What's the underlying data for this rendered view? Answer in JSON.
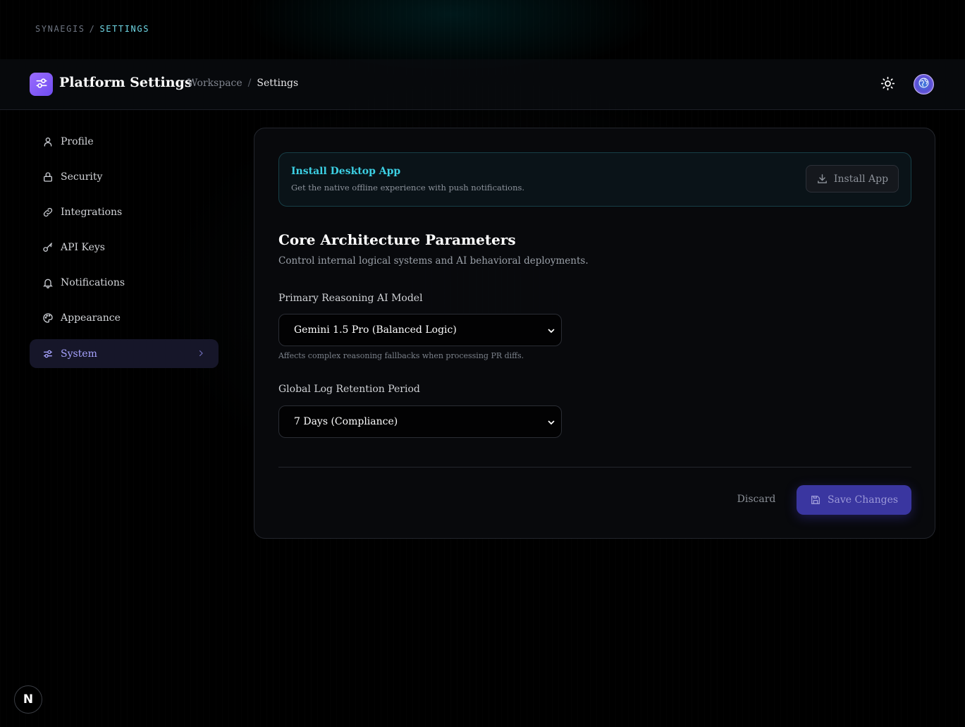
{
  "top_breadcrumb": {
    "root": "SYNAEGIS",
    "separator": "/",
    "current": "SETTINGS"
  },
  "header": {
    "logo_icon": "sliders-icon",
    "title": "Platform Settings",
    "breadcrumb": {
      "parent": "Workspace",
      "separator": "/",
      "current": "Settings"
    },
    "theme_icon": "sun-icon"
  },
  "sidebar": {
    "items": [
      {
        "label": "Profile",
        "icon": "user-icon",
        "active": false
      },
      {
        "label": "Security",
        "icon": "lock-icon",
        "active": false
      },
      {
        "label": "Integrations",
        "icon": "link-icon",
        "active": false
      },
      {
        "label": "API Keys",
        "icon": "key-icon",
        "active": false
      },
      {
        "label": "Notifications",
        "icon": "bell-icon",
        "active": false
      },
      {
        "label": "Appearance",
        "icon": "palette-icon",
        "active": false
      },
      {
        "label": "System",
        "icon": "sliders-icon",
        "active": true
      }
    ]
  },
  "install_banner": {
    "title": "Install Desktop App",
    "description": "Get the native offline experience with push notifications.",
    "button_label": "Install App"
  },
  "section": {
    "title": "Core Architecture Parameters",
    "description": "Control internal logical systems and AI behavioral deployments."
  },
  "fields": {
    "model": {
      "label": "Primary Reasoning AI Model",
      "value": "Gemini 1.5 Pro (Balanced Logic)",
      "hint": "Affects complex reasoning fallbacks when processing PR diffs."
    },
    "retention": {
      "label": "Global Log Retention Period",
      "value": "7 Days (Compliance)"
    }
  },
  "actions": {
    "discard_label": "Discard",
    "save_label": "Save Changes"
  },
  "dev_badge": {
    "letter": "N"
  },
  "colors": {
    "accent_cyan": "#3ccfe3",
    "accent_purple": "#8b5cf6",
    "save_button": "#3a36a0"
  }
}
